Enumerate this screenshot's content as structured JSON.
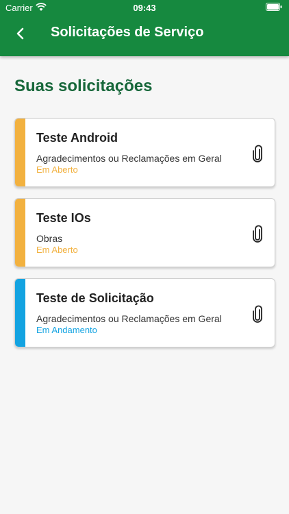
{
  "status_bar": {
    "carrier": "Carrier",
    "time": "09:43"
  },
  "header": {
    "title": "Solicitações de Serviço"
  },
  "section": {
    "title": "Suas solicitações"
  },
  "requests": [
    {
      "title": "Teste Android",
      "category": "Agradecimentos ou Reclamações em Geral",
      "status": "Em Aberto"
    },
    {
      "title": "Teste IOs",
      "category": "Obras",
      "status": "Em Aberto"
    },
    {
      "title": "Teste de Solicitação",
      "category": "Agradecimentos ou Reclamações em Geral",
      "status": "Em Andamento"
    }
  ],
  "colors": {
    "header": "#16893f",
    "title": "#17673a",
    "status_open": "#f2b13f",
    "status_in_progress": "#13a3e1"
  },
  "icons": [
    "wifi-icon",
    "battery-icon",
    "back-arrow-icon",
    "paperclip-icon"
  ]
}
